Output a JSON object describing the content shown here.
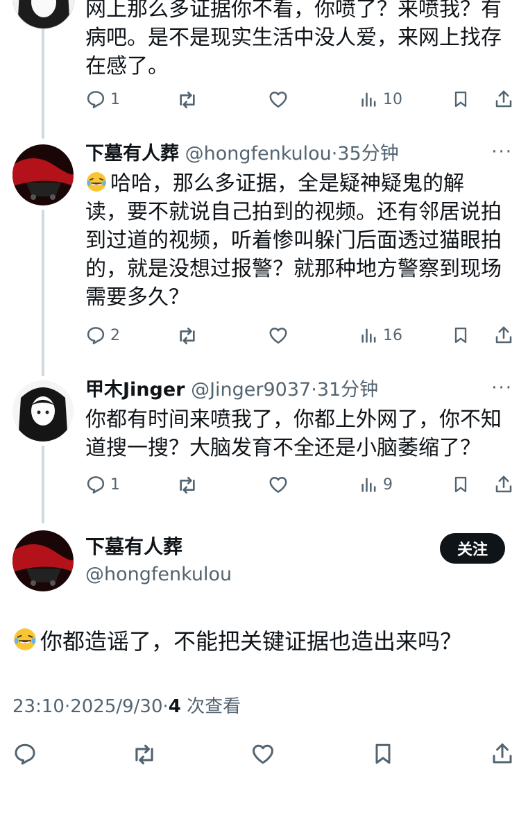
{
  "tweets": [
    {
      "text_lines": [
        "网上那么多证据你不看，你喷了？来喷我？有",
        "病吧。是不是现实生活中没人爱，来网上找存",
        "在感了。"
      ],
      "replies": "1",
      "views": "10"
    },
    {
      "name": "下墓有人葬",
      "handle": "@hongfenkulou",
      "time": "35分钟",
      "text_lines": [
        "哈哈，那么多证据，全是疑神疑鬼的解",
        "读，要不就说自己拍到的视频。还有邻居说拍",
        "到过道的视频，听着惨叫躲门后面透过猫眼拍",
        "的，就是没想过报警？就那种地方警察到现场",
        "需要多久？"
      ],
      "replies": "2",
      "views": "16"
    },
    {
      "name": "甲木Jinger",
      "handle": "@Jinger9037",
      "time": "31分钟",
      "text_lines": [
        "你都有时间来喷我了，你都上外网了，你不知",
        "道搜一搜？大脑发育不全还是小脑萎缩了？"
      ],
      "replies": "1",
      "views": "9"
    }
  ],
  "main": {
    "name": "下墓有人葬",
    "handle": "@hongfenkulou",
    "follow_label": "关注",
    "text": "你都造谣了，不能把关键证据也造出来吗？",
    "time": "23:10",
    "date": "2025/9/30",
    "view_count": "4",
    "view_label": "次查看"
  },
  "separator": "·",
  "more_glyph": "···",
  "icons": [
    "reply-icon",
    "retweet-icon",
    "like-icon",
    "views-icon",
    "bookmark-icon",
    "share-icon",
    "laughing-emoji-icon"
  ],
  "colors": {
    "text": "#0f1419",
    "secondary": "#536471",
    "thread_line": "#cfd9de",
    "follow_bg": "#0f1419"
  }
}
